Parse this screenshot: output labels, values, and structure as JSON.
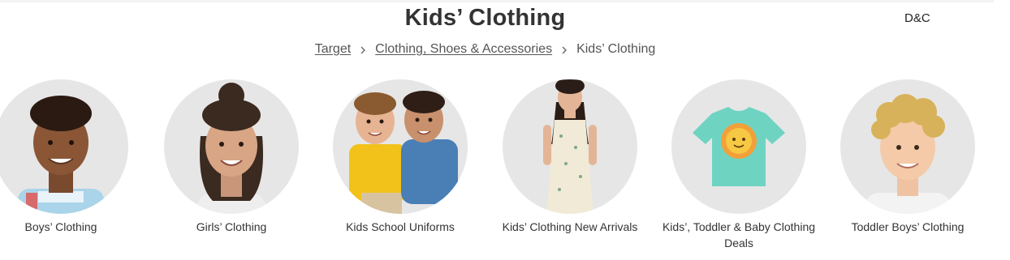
{
  "page": {
    "title": "Kids’ Clothing",
    "corner_note": "D&C"
  },
  "breadcrumb": {
    "items": [
      {
        "label": "Target"
      },
      {
        "label": "Clothing, Shoes & Accessories"
      }
    ],
    "current": "Kids’ Clothing",
    "separator_icon": "chevron-right-icon"
  },
  "categories": [
    {
      "label": "Boys’ Clothing"
    },
    {
      "label": "Girls’ Clothing"
    },
    {
      "label": "Kids School Uniforms"
    },
    {
      "label": "Kids’ Clothing New Arrivals"
    },
    {
      "label": "Kids’, Toddler & Baby Clothing Deals"
    },
    {
      "label": "Toddler Boys’ Clothing"
    }
  ],
  "colors": {
    "circle_bg": "#e6e6e6",
    "title_text": "#333333",
    "link_text": "#555555",
    "tshirt": "#6fd3c2",
    "sun": "#f7b733"
  }
}
